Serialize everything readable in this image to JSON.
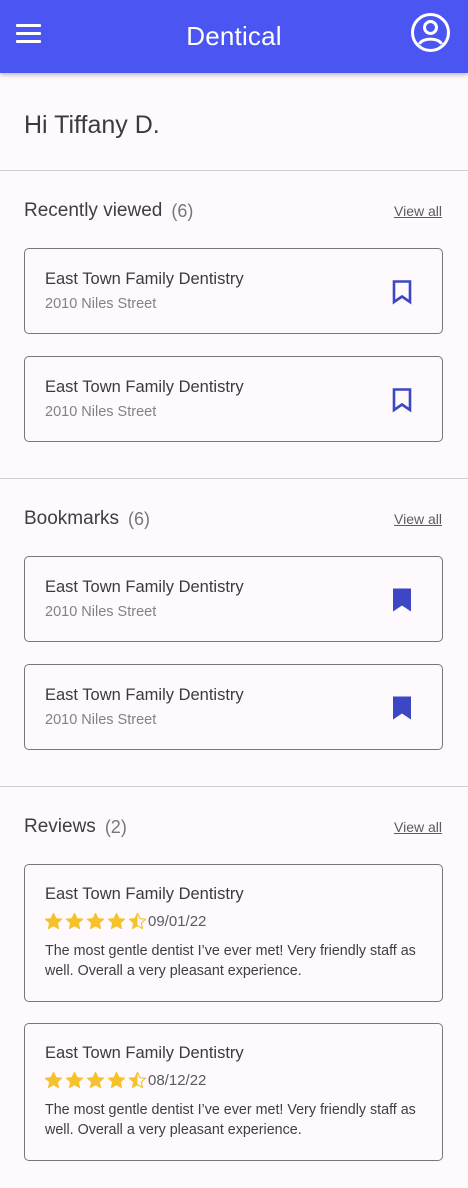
{
  "app": {
    "title": "Dentical"
  },
  "colors": {
    "primary": "#4b56f2",
    "star": "#f5c22c"
  },
  "greeting": "Hi Tiffany D.",
  "recently_viewed": {
    "title": "Recently viewed",
    "count": "(6)",
    "view_all": "View all",
    "items": [
      {
        "name": "East Town Family Dentistry",
        "address": "2010 Niles Street",
        "bookmark_icon": "bookmark-outline-icon"
      },
      {
        "name": "East Town Family Dentistry",
        "address": "2010 Niles Street",
        "bookmark_icon": "bookmark-outline-icon"
      }
    ]
  },
  "bookmarks": {
    "title": "Bookmarks",
    "count": "(6)",
    "view_all": "View all",
    "items": [
      {
        "name": "East Town Family Dentistry",
        "address": "2010 Niles Street",
        "bookmark_icon": "bookmark-filled-icon"
      },
      {
        "name": "East Town Family Dentistry",
        "address": "2010 Niles Street",
        "bookmark_icon": "bookmark-filled-icon"
      }
    ]
  },
  "reviews": {
    "title": "Reviews",
    "count": "(2)",
    "view_all": "View all",
    "items": [
      {
        "name": "East Town Family Dentistry",
        "rating": 4.5,
        "date": "09/01/22",
        "text": "The most gentle dentist I’ve ever met! Very friendly staff as well. Overall a very pleasant experience."
      },
      {
        "name": "East Town Family Dentistry",
        "rating": 4.5,
        "date": "08/12/22",
        "text": "The most gentle dentist I’ve ever met! Very friendly staff as well. Overall a very pleasant experience."
      }
    ]
  }
}
